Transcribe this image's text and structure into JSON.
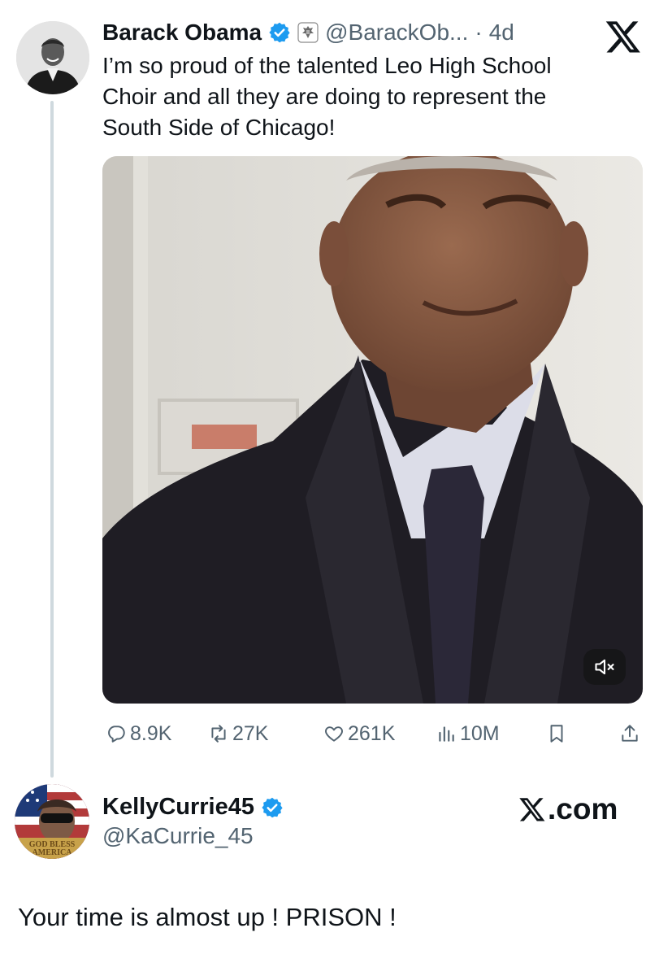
{
  "tweet": {
    "author_name": "Barack Obama",
    "handle": "@BarackOb...",
    "separator": "·",
    "age": "4d",
    "text_lines": [
      "I’m so proud of the talented Leo High School",
      "Choir and all they are doing to represent the",
      "South Side of Chicago!"
    ],
    "stats": {
      "replies": "8.9K",
      "retweets": "27K",
      "likes": "261K",
      "views": "10M"
    },
    "icons": {
      "verified": "verified-badge-icon",
      "affiliation": "government-seal-icon",
      "mute": "speaker-muted-icon"
    }
  },
  "reply": {
    "author_name": "KellyCurrie45",
    "handle": "@KaCurrie_45",
    "text": "Your time is almost up ! PRISON !",
    "avatar_caption": "GOD BLESS AMERICA"
  },
  "watermark": {
    "label": ".com"
  },
  "colors": {
    "verified_blue": "#1d9bf0",
    "text_primary": "#0f1419",
    "text_secondary": "#536471",
    "thread_line": "#cfd9de"
  }
}
